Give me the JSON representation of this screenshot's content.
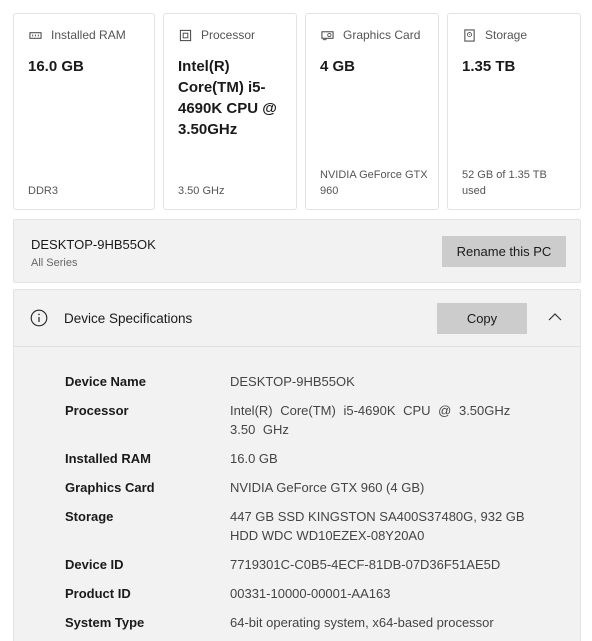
{
  "cards": [
    {
      "icon": "ram-icon",
      "label": "Installed RAM",
      "value": "16.0 GB",
      "foot": "DDR3"
    },
    {
      "icon": "processor-icon",
      "label": "Processor",
      "value": "Intel(R) Core(TM) i5-4690K CPU @ 3.50GHz",
      "foot": "3.50 GHz"
    },
    {
      "icon": "graphics-card-icon",
      "label": "Graphics Card",
      "value": "4 GB",
      "foot": "NVIDIA GeForce GTX 960"
    },
    {
      "icon": "storage-icon",
      "label": "Storage",
      "value": "1.35 TB",
      "foot": "52 GB of 1.35 TB used"
    }
  ],
  "pc": {
    "name": "DESKTOP-9HB55OK",
    "subtitle": "All Series",
    "rename_label": "Rename this PC"
  },
  "specs": {
    "title": "Device Specifications",
    "copy_label": "Copy",
    "rows": [
      {
        "label": "Device Name",
        "value": "DESKTOP-9HB55OK"
      },
      {
        "label": "Processor",
        "value": "Intel(R) Core(TM) i5-4690K CPU @ 3.50GHz 3.50 GHz"
      },
      {
        "label": "Installed RAM",
        "value": "16.0 GB"
      },
      {
        "label": "Graphics Card",
        "value": "NVIDIA GeForce GTX 960 (4 GB)"
      },
      {
        "label": "Storage",
        "value": "447 GB SSD KINGSTON SA400S37480G, 932 GB HDD WDC WD10EZEX-08Y20A0"
      },
      {
        "label": "Device ID",
        "value": "7719301C-C0B5-4ECF-81DB-07D36F51AE5D"
      },
      {
        "label": "Product ID",
        "value": "00331-10000-00001-AA163"
      },
      {
        "label": "System Type",
        "value": "64-bit operating system, x64-based processor"
      }
    ]
  }
}
